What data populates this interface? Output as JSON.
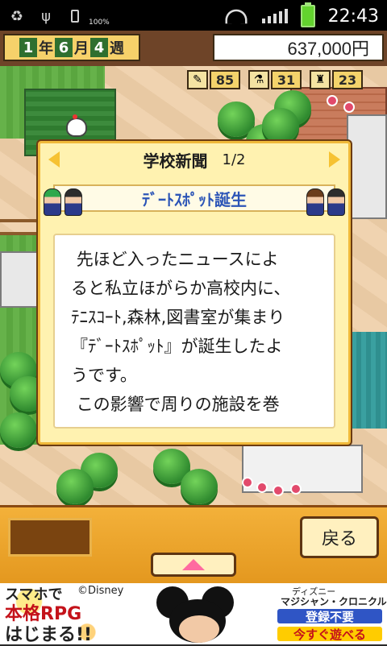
{
  "status_bar": {
    "battery_percent": "100%",
    "time": "22:43",
    "icons": [
      "recycle-icon",
      "usb-icon",
      "battery-icon",
      "wifi-icon",
      "signal-icon"
    ]
  },
  "hud": {
    "year_num": "1",
    "year_kanji": "年",
    "month_num": "6",
    "month_kanji": "月",
    "week_num": "4",
    "week_kanji": "週",
    "money": "637,000円"
  },
  "stats": [
    {
      "icon": "pencil-icon",
      "value": "85"
    },
    {
      "icon": "flask-icon",
      "value": "31"
    },
    {
      "icon": "trophy-icon",
      "value": "23"
    }
  ],
  "dialog": {
    "title": "学校新聞",
    "page": "1/2",
    "headline": "ﾃﾞｰﾄｽﾎﾟｯﾄ誕生",
    "body": " 先ほど入ったニュースによ\nると私立ほがらか高校内に、\nﾃﾆｽｺｰﾄ,森林,図書室が集まり\n『ﾃﾞｰﾄｽﾎﾟｯﾄ』が誕生したよ\nうです。\n この影響で周りの施設を巻"
  },
  "bottom": {
    "back_label": "戻る"
  },
  "ad": {
    "line1": "スマホで",
    "line2": "本格RPG",
    "line3": "はじまる!!",
    "copyright": "©Disney",
    "right1": "ディズニー",
    "right2": "マジシャン・クロニクル",
    "right3": "登録不要",
    "right4": "今すぐ遊べる"
  },
  "colors": {
    "dialog_bg": "#fff2b0",
    "headline_text": "#2c55b7",
    "bottom_bar": "#e3971e"
  }
}
